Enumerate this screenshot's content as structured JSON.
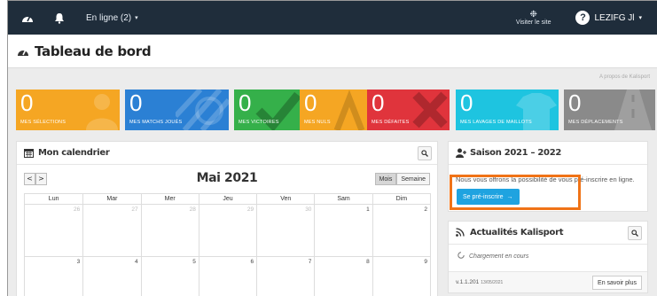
{
  "navbar": {
    "status_label": "En ligne (2)",
    "visit_label": "Visiter le site",
    "user_label": "LEZIFG Jl"
  },
  "page": {
    "title": "Tableau de bord",
    "about_link": "A propos de Kalisport"
  },
  "tiles": [
    {
      "value": "0",
      "label": "MES SÉLECTIONS",
      "color": "#f5a623"
    },
    {
      "value": "0",
      "label": "MES MATCHS JOUÉS",
      "color": "#2b80d4"
    },
    {
      "value": "0",
      "label": "MES VICTOIRES",
      "color": "#35b04a"
    },
    {
      "value": "0",
      "label": "MES NULS",
      "color": "#f5a623"
    },
    {
      "value": "0",
      "label": "MES DÉFAITES",
      "color": "#e0343c"
    },
    {
      "value": "0",
      "label": "MES LAVAGES DE MAILLOTS",
      "color": "#1ec4e0"
    },
    {
      "value": "0",
      "label": "MES DÉPLACEMENTS",
      "color": "#8a8a8a"
    }
  ],
  "calendar": {
    "title": "Mon calendrier",
    "prev": "<",
    "next": ">",
    "month": "Mai 2021",
    "view_month": "Mois",
    "view_week": "Semaine",
    "days": [
      "Lun",
      "Mar",
      "Mer",
      "Jeu",
      "Ven",
      "Sam",
      "Dim"
    ],
    "weeks": [
      [
        "26",
        "27",
        "28",
        "29",
        "30",
        "1",
        "2"
      ],
      [
        "3",
        "4",
        "5",
        "6",
        "7",
        "8",
        "9"
      ]
    ]
  },
  "season": {
    "title": "Saison 2021 – 2022",
    "text": "Nous vous offrons la possibilité de vous pré-inscrire en ligne.",
    "button": "Se pré-inscrire"
  },
  "news": {
    "title": "Actualités Kalisport",
    "loading": "Chargement en cours",
    "version": "v.1.1.201",
    "version_date": "13/05/2021",
    "more": "En savoir plus"
  },
  "colors": {
    "navbar": "#1f2d3b",
    "accent_button": "#1fa3e0",
    "highlight": "#f07317"
  }
}
